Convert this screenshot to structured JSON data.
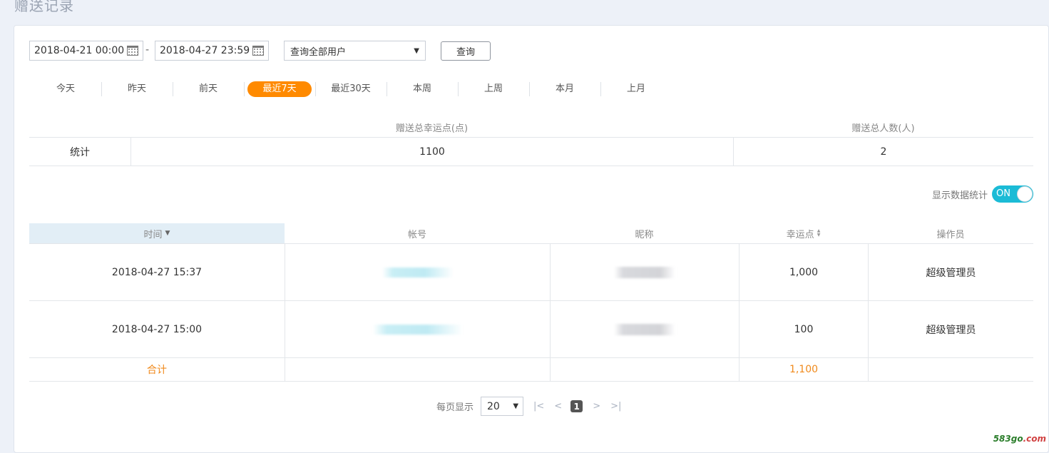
{
  "page": {
    "title": "赠送记录"
  },
  "filters": {
    "start_date": "2018-04-21 00:00",
    "separator": "-",
    "end_date": "2018-04-27 23:59",
    "user_select": "查询全部用户",
    "query_label": "查询"
  },
  "ranges": [
    "今天",
    "昨天",
    "前天",
    "最近7天",
    "最近30天",
    "本周",
    "上周",
    "本月",
    "上月"
  ],
  "active_range": "最近7天",
  "summary": {
    "header_points": "赠送总幸运点(点)",
    "header_people": "赠送总人数(人)",
    "row_label": "统计",
    "total_points": "1100",
    "total_people": "2"
  },
  "toggle": {
    "label": "显示数据统计",
    "state": "ON"
  },
  "table": {
    "headers": {
      "time": "时间",
      "account": "帐号",
      "nickname": "昵称",
      "points": "幸运点",
      "operator": "操作员"
    },
    "rows": [
      {
        "time": "2018-04-27 15:37",
        "points": "1,000",
        "operator": "超级管理员"
      },
      {
        "time": "2018-04-27 15:00",
        "points": "100",
        "operator": "超级管理员"
      }
    ],
    "total_label": "合计",
    "total_points": "1,100"
  },
  "pagination": {
    "per_page_label": "每页显示",
    "page_size": "20",
    "current_page": "1"
  },
  "watermark": {
    "text": "583go",
    "domain": ".com"
  },
  "colors": {
    "accent": "#ff8a00",
    "toggle": "#1bbbd6",
    "total_text": "#f08a1c"
  }
}
